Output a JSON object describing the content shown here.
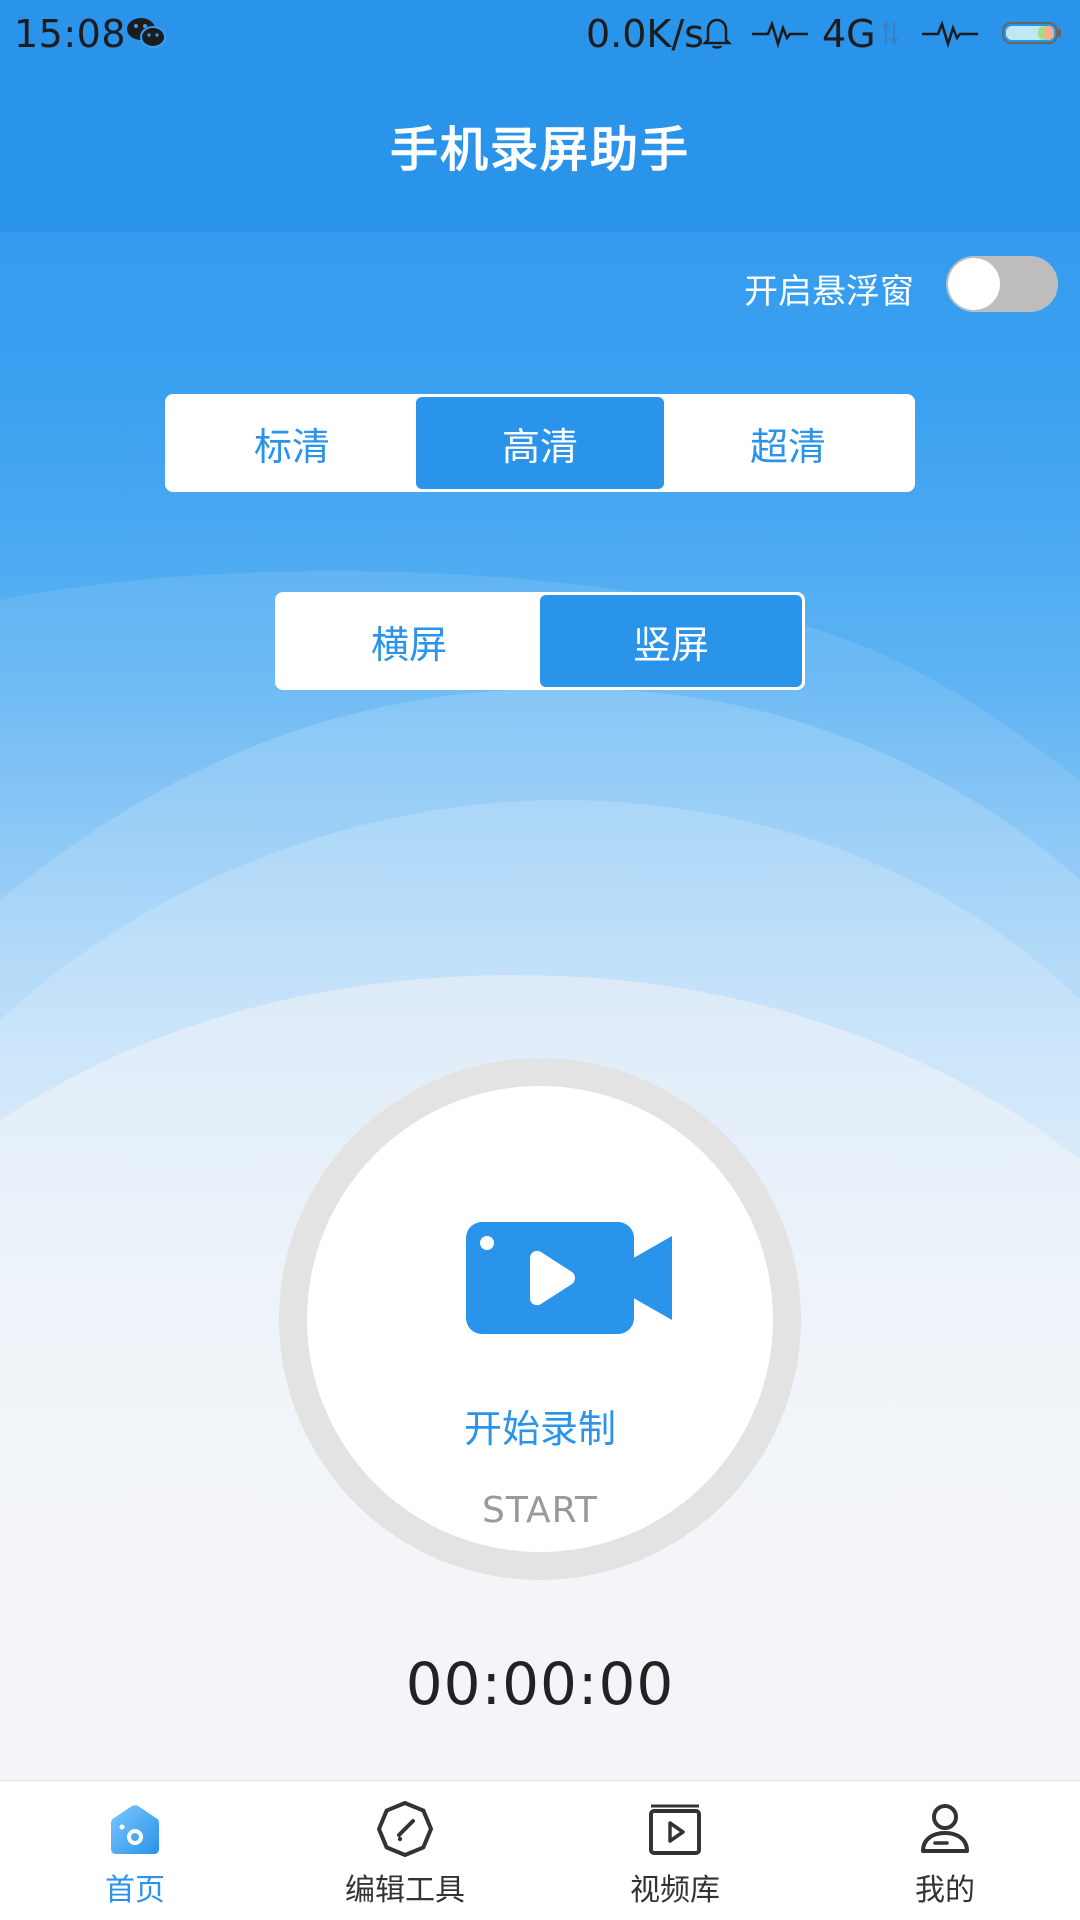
{
  "status_bar": {
    "time": "15:08",
    "speed": "0.0K/s",
    "network": "4G",
    "icons": [
      "wechat-icon",
      "bell-icon",
      "pulse-icon",
      "data-arrows-icon",
      "pulse-icon",
      "battery-icon"
    ]
  },
  "header": {
    "title": "手机录屏助手"
  },
  "float_window": {
    "label": "开启悬浮窗",
    "enabled": false
  },
  "quality": {
    "options": [
      "标清",
      "高清",
      "超清"
    ],
    "selected": "高清"
  },
  "orientation": {
    "options": [
      "横屏",
      "竖屏"
    ],
    "selected": "竖屏"
  },
  "record": {
    "label": "开始录制",
    "sub_label": "START",
    "timer": "00:00:00"
  },
  "nav": {
    "items": [
      {
        "label": "首页",
        "icon": "home-icon",
        "active": true
      },
      {
        "label": "编辑工具",
        "icon": "edit-tools-icon",
        "active": false
      },
      {
        "label": "视频库",
        "icon": "video-library-icon",
        "active": false
      },
      {
        "label": "我的",
        "icon": "profile-icon",
        "active": false
      }
    ]
  },
  "colors": {
    "accent": "#2a93ea",
    "toggle_off": "#bdbdbd",
    "ring": "#e3e3e3",
    "background": "#f2f4f7"
  }
}
